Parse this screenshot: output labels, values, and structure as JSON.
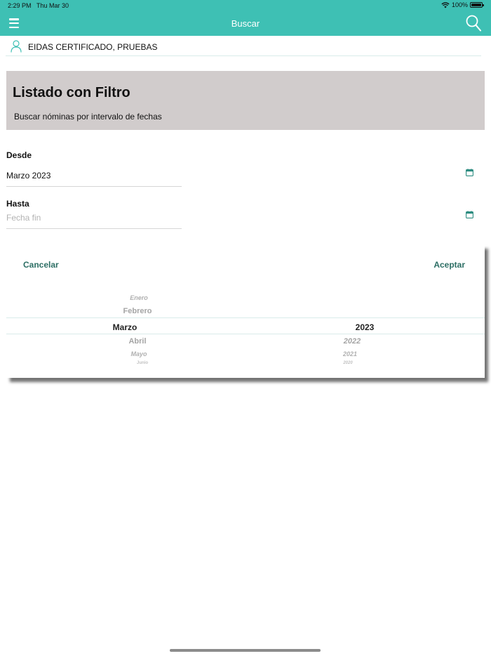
{
  "status_bar": {
    "time": "2:29 PM",
    "date": "Thu Mar 30",
    "battery": "100%",
    "battery_level": 1.0,
    "wifi_icon": "wifi-icon"
  },
  "header": {
    "title": "Buscar",
    "background": "#3ec0b4",
    "menu_icon": "menu-icon",
    "search_icon": "search-icon"
  },
  "user": {
    "name": "EIDAS CERTIFICADO, PRUEBAS",
    "icon": "user-icon"
  },
  "filter": {
    "title": "Listado con Filtro",
    "subtitle": "Buscar nóminas por intervalo de fechas",
    "background": "#d1cccc"
  },
  "fields": {
    "desde": {
      "label": "Desde",
      "value": "Marzo 2023",
      "icon": "calendar-icon"
    },
    "hasta": {
      "label": "Hasta",
      "placeholder": "Fecha fin",
      "icon": "calendar-icon"
    }
  },
  "picker": {
    "cancel_label": "Cancelar",
    "accept_label": "Aceptar",
    "accent": "#2c6e64",
    "months": [
      "Enero",
      "Febrero",
      "Marzo",
      "Abril",
      "Mayo",
      "Junio"
    ],
    "years": [
      "2023",
      "2022",
      "2021",
      "2020"
    ],
    "selected_month": "Marzo",
    "selected_year": "2023"
  }
}
